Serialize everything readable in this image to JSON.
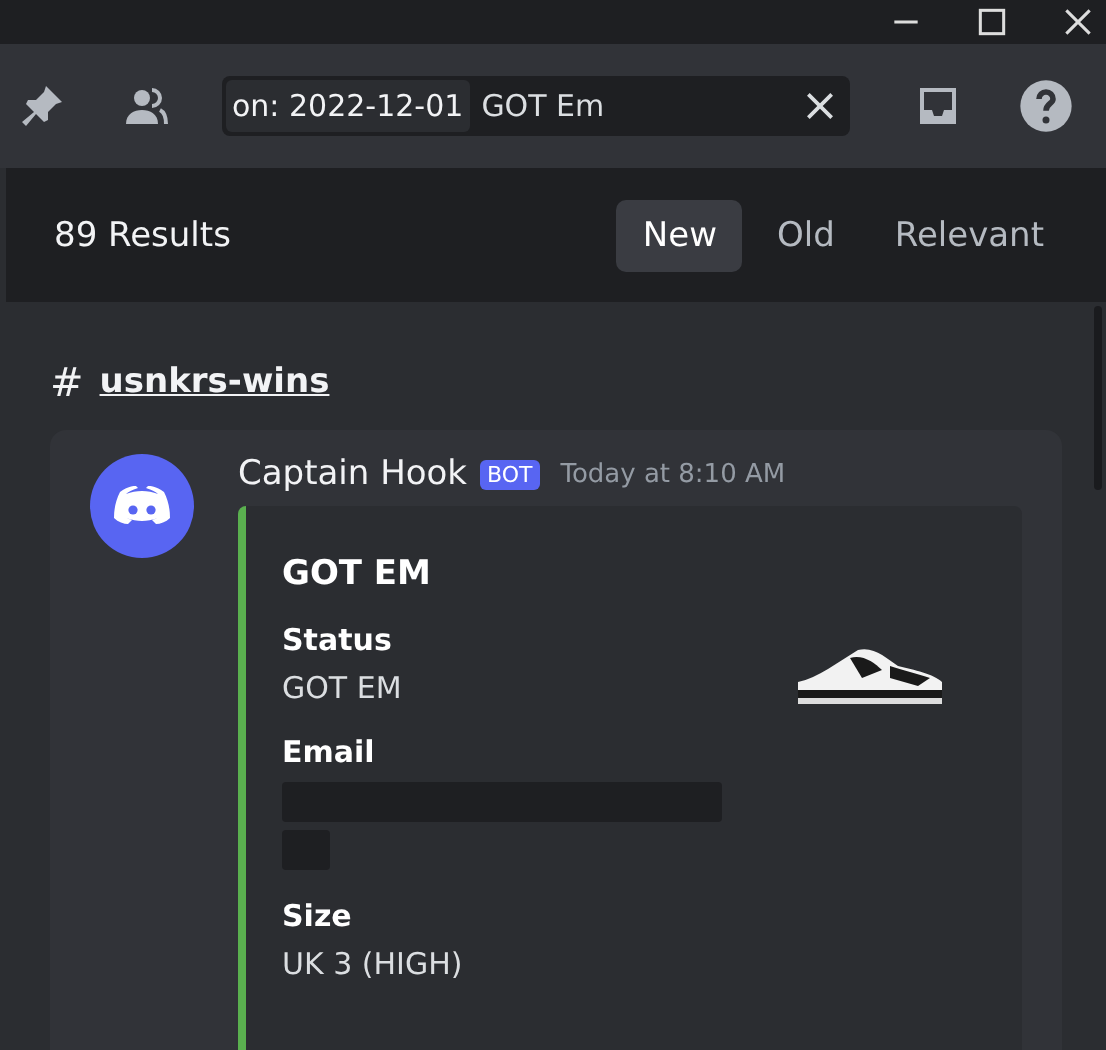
{
  "toolbar": {
    "search": {
      "filter": "on: 2022-12-01",
      "value": "GOT Em"
    }
  },
  "results": {
    "count": "89 Results",
    "sort_tabs": [
      {
        "label": "New",
        "selected": true
      },
      {
        "label": "Old",
        "selected": false
      },
      {
        "label": "Relevant",
        "selected": false
      }
    ]
  },
  "channel": {
    "hash": "#",
    "name": "usnkrs-wins"
  },
  "message": {
    "author": "Captain Hook",
    "badge": "BOT",
    "time": "Today at 8:10 AM",
    "embed": {
      "title": "GOT EM",
      "color": "#5ab04f",
      "fields": [
        {
          "kind": "text",
          "name": "Status",
          "value": "GOT EM"
        },
        {
          "kind": "redacted",
          "name": "Email"
        },
        {
          "kind": "text",
          "name": "Size",
          "value": "UK 3 (HIGH)"
        }
      ]
    }
  }
}
